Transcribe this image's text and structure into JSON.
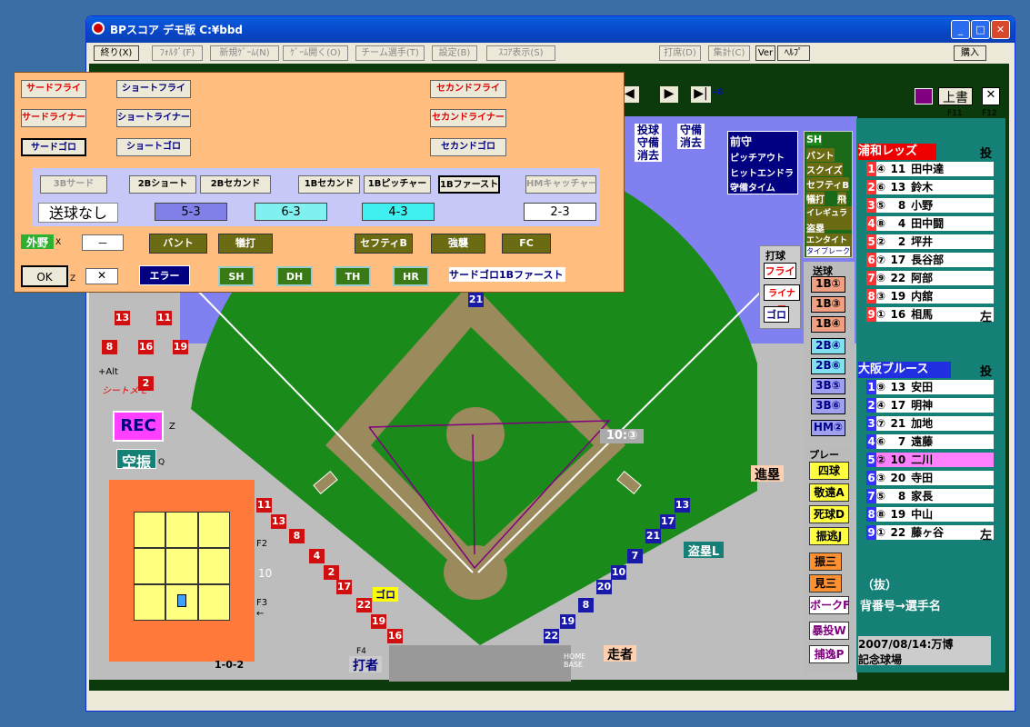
{
  "window": {
    "title": "BPスコア デモ版 C:¥bbd",
    "min": "_",
    "max": "□",
    "close": "✕"
  },
  "menu": {
    "end": "終り(X)",
    "folder": "ﾌｫﾙﾀﾞ(F)",
    "new_game": "新規ｹﾞｰﾑ(N)",
    "open_game": "ｹﾞｰﾑ開く(O)",
    "team": "チーム選手(T)",
    "settings": "設定(B)",
    "score_view": "ｽｺｱ表示(S)",
    "atbat": "打席(D)",
    "stats": "集計(C)",
    "ver": "Ver",
    "help": "ﾍﾙﾌﾟ",
    "buy": "購入"
  },
  "panel": {
    "row1": [
      "サードフライ",
      "ショートフライ",
      "セカンドフライ"
    ],
    "row2": [
      "サードライナー",
      "ショートライナー",
      "セカンドライナー"
    ],
    "row3": [
      "サードゴロ",
      "ショートゴロ",
      "セカンドゴロ"
    ],
    "fielders": [
      "3Bサード",
      "2Bショート",
      "2Bセカンド",
      "1Bセカンド",
      "1Bピッチャー",
      "1Bファースト",
      "HMキャッチャー"
    ],
    "no_throw": "送球なし",
    "combos": [
      "5-3",
      "6-3",
      "4-3",
      "2-3"
    ],
    "outfield": "外野",
    "outfield_key": "X",
    "dash": "－",
    "plays": [
      "バント",
      "犠打",
      "セフティB",
      "強襲",
      "FC"
    ],
    "ok": "OK",
    "ok_key": "Z",
    "cancel": "✕",
    "error": "エラー",
    "extras": [
      "SH",
      "DH",
      "TH",
      "HR"
    ],
    "result": "サードゴロ1Bファースト"
  },
  "nav": {
    "prev": "◀",
    "next": "▶",
    "last": "▶|",
    "right_hint": ">",
    "left_hint": "<",
    "nav_plus": "+8",
    "overwrite": "上書",
    "x": "✕",
    "f11": "F11",
    "f12": "F12"
  },
  "top_controls": {
    "pitch_erase": [
      "投球",
      "守備",
      "消去"
    ],
    "def_erase": [
      "守備",
      "消去"
    ],
    "front": "前守",
    "pickoff": "ピッチアウト",
    "hitrun": "ヒットエンドラン",
    "timeout": "守備タイム"
  },
  "right_buttons": [
    "SH",
    "バント",
    "スクイズ",
    "セフティB",
    "犠打",
    "飛",
    "イレギュラー",
    "盗塁",
    "エンタイトル",
    "タイブレーク"
  ],
  "bat": {
    "title": "打球",
    "fly": "フライ",
    "liner": "ライナー",
    "goro": "ゴロ"
  },
  "throw": {
    "title": "送球",
    "items": [
      "1B①",
      "1B③",
      "1B④",
      "2B④",
      "2B⑥",
      "3B⑤",
      "3B⑥",
      "HM②"
    ]
  },
  "plays_title": "プレー",
  "play_buttons": [
    "四球",
    "敬遠A",
    "死球D",
    "振逃J",
    "振三",
    "見三",
    "ボークF",
    "暴投W",
    "捕逸P"
  ],
  "labels": {
    "steal": "盗塁L",
    "advance": "進塁",
    "runner": "走者",
    "batter": "打者",
    "homebase": "HOME BASE",
    "rec": "REC",
    "rec_key": "Z",
    "swing": "空振",
    "swing_key": "Q",
    "alt": "+Alt",
    "sheet_memo": "シートメモ",
    "count": "1-0-2",
    "f2": "F2",
    "f3": "F3",
    "f4": "F4",
    "ten": "10",
    "goro_tag": "ゴロ",
    "home_tag": "10:③",
    "arrow": "←"
  },
  "team1": {
    "name": "浦和レッズ",
    "tag": "投",
    "players": [
      {
        "o": "1",
        "p": "④",
        "n": "11",
        "name": "田中達"
      },
      {
        "o": "2",
        "p": "⑥",
        "n": "13",
        "name": "鈴木"
      },
      {
        "o": "3",
        "p": "⑤",
        "n": "8",
        "name": "小野"
      },
      {
        "o": "4",
        "p": "⑧",
        "n": "4",
        "name": "田中闘"
      },
      {
        "o": "5",
        "p": "②",
        "n": "2",
        "name": "坪井"
      },
      {
        "o": "6",
        "p": "⑦",
        "n": "17",
        "name": "長谷部"
      },
      {
        "o": "7",
        "p": "⑨",
        "n": "22",
        "name": "阿部"
      },
      {
        "o": "8",
        "p": "③",
        "n": "19",
        "name": "内舘"
      },
      {
        "o": "9",
        "p": "①",
        "n": "16",
        "name": "相馬"
      }
    ],
    "left": "左"
  },
  "team2": {
    "name": "大阪ブルース",
    "tag": "投",
    "players": [
      {
        "o": "1",
        "p": "⑨",
        "n": "13",
        "name": "安田"
      },
      {
        "o": "2",
        "p": "④",
        "n": "17",
        "name": "明神"
      },
      {
        "o": "3",
        "p": "⑦",
        "n": "21",
        "name": "加地"
      },
      {
        "o": "4",
        "p": "⑥",
        "n": "7",
        "name": "遠藤"
      },
      {
        "o": "5",
        "p": "②",
        "n": "10",
        "name": "二川"
      },
      {
        "o": "6",
        "p": "③",
        "n": "20",
        "name": "寺田"
      },
      {
        "o": "7",
        "p": "⑤",
        "n": "8",
        "name": "家長"
      },
      {
        "o": "8",
        "p": "⑧",
        "n": "19",
        "name": "中山"
      },
      {
        "o": "9",
        "p": "①",
        "n": "22",
        "name": "藤ヶ谷"
      }
    ],
    "left": "左"
  },
  "bottom": {
    "sub": "（抜）",
    "back": "背番号→選手名",
    "date": "2007/08/14:万博",
    "venue": "記念球場"
  },
  "field_numbers": {
    "red": [
      "13",
      "11",
      "8",
      "16",
      "19",
      "2",
      "11",
      "13",
      "8",
      "4",
      "2",
      "17",
      "22",
      "19",
      "16"
    ],
    "blue": [
      "21",
      "13",
      "17",
      "21",
      "7",
      "10",
      "20",
      "8",
      "19",
      "22"
    ]
  },
  "colors": {
    "infield_bg": "#8080f0",
    "grass": "#1a8a1a",
    "dirt": "#9b8a5c",
    "panel": "#ffbd80",
    "roster": "#158075"
  }
}
